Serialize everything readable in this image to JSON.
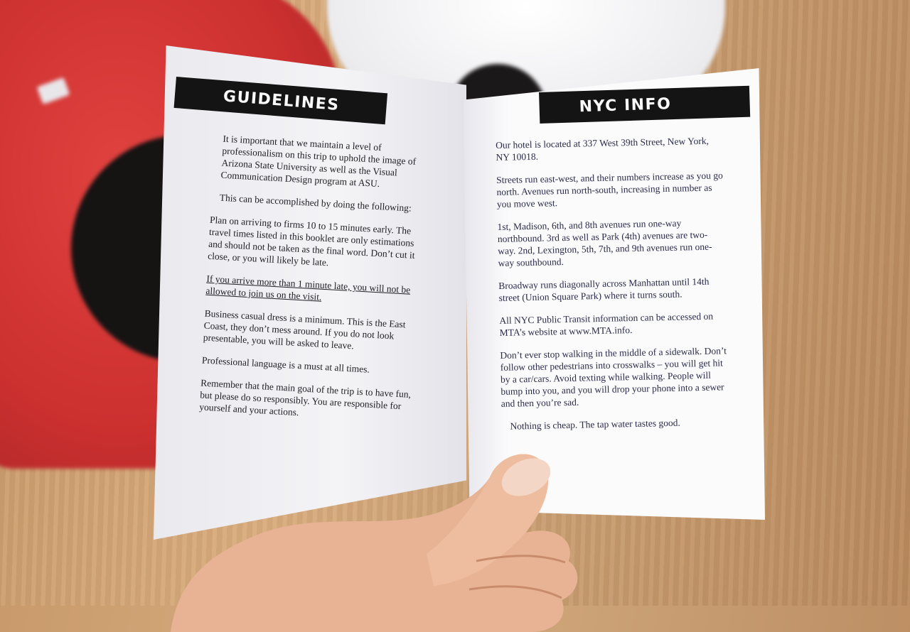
{
  "left_page": {
    "heading": "GUIDELINES",
    "p1": "It is important that we maintain a level of professionalism on this trip to uphold the image of Arizona State University as well as the Visual Communication Design program at ASU.",
    "p2": "This can be accomplished by doing the following:",
    "p3": "Plan on arriving to firms 10 to 15 minutes early. The travel times listed in this booklet are only estimations and should not be taken as the final word. Don’t cut it close, or you will likely be late.",
    "p4": "If you arrive more than 1 minute late, you will not be allowed to join us on the visit.",
    "p5": "Business casual dress is a minimum. This is the East Coast, they don’t mess around. If you do not look presentable, you will be asked to leave.",
    "p6": "Professional language is a must at all times.",
    "p7": "Remember that the main goal of the trip is to have fun, but please do so responsibly. You are responsible for yourself and your actions."
  },
  "right_page": {
    "heading": "NYC INFO",
    "p1": "Our hotel is located at 337 West 39th Street, New York, NY 10018.",
    "p2": "Streets run east-west, and their numbers increase as you go north. Avenues run north-south, increasing in number as you move west.",
    "p3": "1st, Madison, 6th, and 8th avenues run one-way northbound. 3rd as well as Park (4th) avenues are two-way. 2nd, Lexington, 5th, 7th, and 9th avenues run one-way southbound.",
    "p4": "Broadway runs diagonally across Manhattan until 14th street (Union Square Park) where it turns south.",
    "p5": "All NYC Public Transit information can be accessed on MTA’s website at www.MTA.info.",
    "p6": "Don’t ever stop walking in the middle of a sidewalk. Don’t follow other pedestrians into crosswalks – you will get hit by a car/cars. Avoid texting while walking. People will bump into you, and you will drop your phone into a sewer and then you’re sad.",
    "p7": "Nothing is cheap. The tap water tastes good."
  },
  "colors": {
    "table_wood": "#d2a576",
    "red_shirt": "#cc302f",
    "heading_bar": "#141414",
    "paper": "#f6f6f8"
  }
}
